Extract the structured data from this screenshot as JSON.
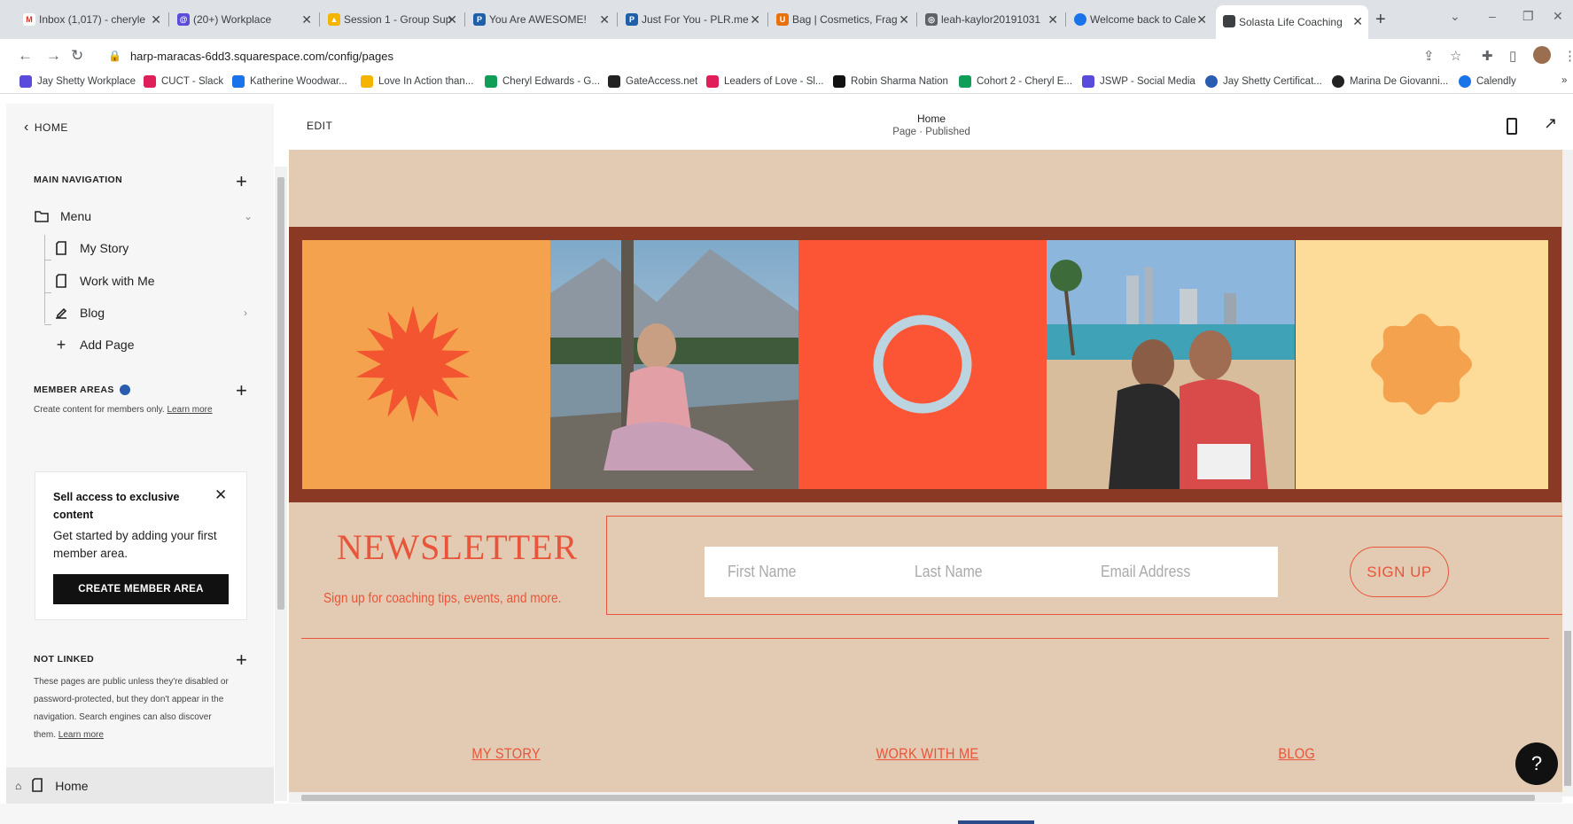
{
  "browser": {
    "tabs": [
      {
        "title": "Inbox (1,017) - cheryle",
        "color": "#d93025",
        "glyph": "M"
      },
      {
        "title": "(20+) Workplace",
        "color": "#5b4bdb",
        "glyph": "@"
      },
      {
        "title": "Session 1 - Group Sup",
        "color": "#f4b400",
        "glyph": "▲"
      },
      {
        "title": "You Are AWESOME!",
        "color": "#1f5fa9",
        "glyph": "P"
      },
      {
        "title": "Just For You - PLR.me",
        "color": "#1f5fa9",
        "glyph": "P"
      },
      {
        "title": "Bag | Cosmetics, Frag",
        "color": "#e8710a",
        "glyph": "U"
      },
      {
        "title": "leah-kaylor20191031",
        "color": "#5f6368",
        "glyph": "◎"
      },
      {
        "title": "Welcome back to Cale",
        "color": "#1a73e8",
        "glyph": "●"
      },
      {
        "title": "Solasta Life Coaching",
        "color": "#3c4043",
        "glyph": "■"
      }
    ],
    "url": "harp-maracas-6dd3.squarespace.com/config/pages",
    "bookmarks": [
      {
        "label": "Jay Shetty Workplace",
        "color": "#5b4bdb"
      },
      {
        "label": "CUCT - Slack",
        "color": "#e01e5a"
      },
      {
        "label": "Katherine Woodwar...",
        "color": "#1a73e8"
      },
      {
        "label": "Love In Action than...",
        "color": "#f4b400"
      },
      {
        "label": "Cheryl Edwards - G...",
        "color": "#0f9d58"
      },
      {
        "label": "GateAccess.net",
        "color": "#222222"
      },
      {
        "label": "Leaders of Love - Sl...",
        "color": "#e01e5a"
      },
      {
        "label": "Robin Sharma Nation",
        "color": "#111111"
      },
      {
        "label": "Cohort 2 - Cheryl E...",
        "color": "#0f9d58"
      },
      {
        "label": "JSWP - Social Media",
        "color": "#5b4bdb"
      },
      {
        "label": "Jay Shetty Certificat...",
        "color": "#2a5db0"
      },
      {
        "label": "Marina De Giovanni...",
        "color": "#222222"
      },
      {
        "label": "Calendly",
        "color": "#1a73e8"
      }
    ],
    "bookmarks_more": "»"
  },
  "sidebar": {
    "back_label": "HOME",
    "main_nav_title": "MAIN NAVIGATION",
    "menu_label": "Menu",
    "pages": [
      "My Story",
      "Work with Me",
      "Blog"
    ],
    "add_page_label": "Add Page",
    "member_areas_title": "MEMBER AREAS",
    "member_desc": "Create content for members only.",
    "learn_more": "Learn more",
    "card": {
      "title": "Sell access to exclusive content",
      "body": "Get started by adding your first member area.",
      "button": "CREATE MEMBER AREA"
    },
    "not_linked_title": "NOT LINKED",
    "not_linked_desc": [
      "These pages are public unless they're disabled or",
      "password-protected, but they don't appear in the",
      "navigation. Search engines can also discover"
    ],
    "not_linked_last": "them.",
    "home_page_label": "Home"
  },
  "editor": {
    "edit_label": "EDIT",
    "page_title": "Home",
    "page_status": "Page · Published"
  },
  "site": {
    "colors": {
      "accent": "#e8553a",
      "background": "#e2cbb2",
      "band": "#8a3a24"
    },
    "newsletter_title": "NEWSLETTER",
    "newsletter_subtitle": "Sign up for coaching tips, events, and more.",
    "fields": [
      "First Name",
      "Last Name",
      "Email Address"
    ],
    "signup_label": "SIGN UP",
    "footer_links": [
      "MY STORY",
      "WORK WITH ME",
      "BLOG"
    ],
    "help_label": "?"
  }
}
